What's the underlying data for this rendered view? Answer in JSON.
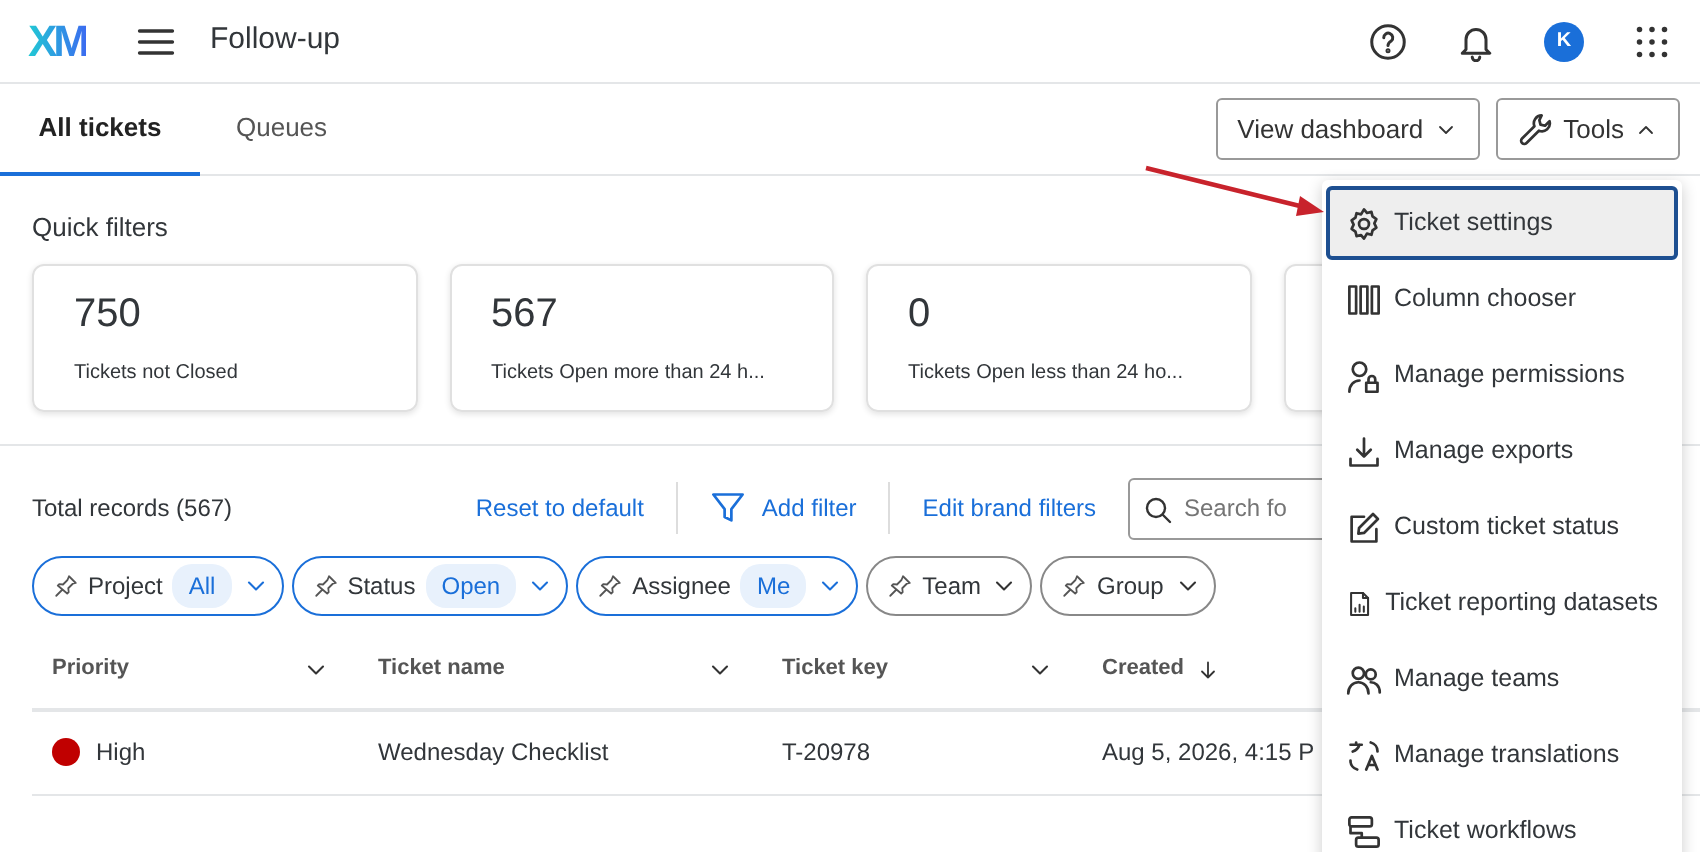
{
  "header": {
    "logo": "XM",
    "title": "Follow-up",
    "avatar": "K"
  },
  "tabs": [
    {
      "label": "All tickets",
      "selected": true
    },
    {
      "label": "Queues",
      "selected": false
    }
  ],
  "actions": [
    {
      "label": "View dashboard",
      "expanded": false
    },
    {
      "label": "Tools",
      "expanded": true
    }
  ],
  "quick_filters": {
    "title": "Quick filters",
    "cards": [
      {
        "count": "750",
        "label": "Tickets not Closed"
      },
      {
        "count": "567",
        "label": "Tickets Open more than 24 h..."
      },
      {
        "count": "0",
        "label": "Tickets Open less than 24 ho..."
      }
    ]
  },
  "toolbar": {
    "total": "Total records (567)",
    "links": [
      "Reset to default",
      "Add filter",
      "Edit brand filters"
    ],
    "search": {
      "placeholder": "Search fo"
    }
  },
  "filters": [
    {
      "label": "Project",
      "value": "All",
      "active": true
    },
    {
      "label": "Status",
      "value": "Open",
      "active": true
    },
    {
      "label": "Assignee",
      "value": "Me",
      "active": true
    },
    {
      "label": "Team",
      "active": false
    },
    {
      "label": "Group",
      "active": false
    }
  ],
  "table": {
    "columns": [
      {
        "label": "Priority",
        "sorted": false
      },
      {
        "label": "Ticket name",
        "sorted": false
      },
      {
        "label": "Ticket key",
        "sorted": false
      },
      {
        "label": "Created",
        "sorted": true
      }
    ],
    "rows": [
      {
        "priority": "High",
        "color": "#c00000",
        "name": "Wednesday Checklist",
        "key": "T-20978",
        "created": "Aug 5, 2026, 4:15 P"
      }
    ]
  },
  "tools_menu": [
    {
      "label": "Ticket settings",
      "selected": true
    },
    {
      "label": "Column chooser",
      "selected": false
    },
    {
      "label": "Manage permissions",
      "selected": false
    },
    {
      "label": "Manage exports",
      "selected": false
    },
    {
      "label": "Custom ticket status",
      "selected": false
    },
    {
      "label": "Ticket reporting datasets",
      "selected": false
    },
    {
      "label": "Manage teams",
      "selected": false
    },
    {
      "label": "Manage translations",
      "selected": false
    },
    {
      "label": "Ticket workflows",
      "selected": false
    }
  ]
}
